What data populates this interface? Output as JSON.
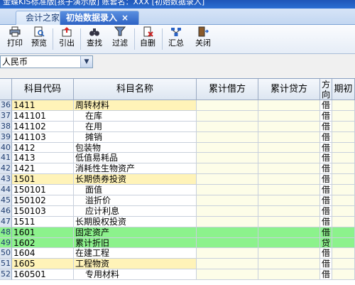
{
  "titlebar": {
    "text": "金蝶KIS标准版[孩子演示版]  账套名：XXX  [初始数据录入]"
  },
  "tabs": [
    {
      "label": "会计之家",
      "active": false
    },
    {
      "label": "初始数据录入",
      "active": true,
      "close": "×"
    }
  ],
  "toolbar": {
    "buttons": [
      {
        "label": "打印",
        "icon": "printer-icon"
      },
      {
        "label": "预览",
        "icon": "preview-icon"
      },
      {
        "label": "引出",
        "icon": "export-icon"
      },
      {
        "label": "查找",
        "icon": "binoculars-icon"
      },
      {
        "label": "过滤",
        "icon": "filter-icon"
      },
      {
        "label": "自删",
        "icon": "delete-icon"
      },
      {
        "label": "汇总",
        "icon": "summary-icon"
      },
      {
        "label": "关闭",
        "icon": "close-door-icon"
      }
    ]
  },
  "currency": {
    "value": "人民币",
    "arrow": "▼"
  },
  "grid": {
    "headers": {
      "code": "科目代码",
      "name": "科目名称",
      "debit": "累计借方",
      "credit": "累计贷方",
      "dir": "方向",
      "end": "期初"
    },
    "rows": [
      {
        "num": "36",
        "code": "1411",
        "name": "周转材料",
        "dir": "借",
        "style": "hl"
      },
      {
        "num": "37",
        "code": "141101",
        "name": "在库",
        "dir": "借",
        "indent": true
      },
      {
        "num": "38",
        "code": "141102",
        "name": "在用",
        "dir": "借",
        "indent": true
      },
      {
        "num": "39",
        "code": "141103",
        "name": "摊销",
        "dir": "借",
        "indent": true
      },
      {
        "num": "40",
        "code": "1412",
        "name": "包装物",
        "dir": "借"
      },
      {
        "num": "41",
        "code": "1413",
        "name": "低值易耗品",
        "dir": "借"
      },
      {
        "num": "42",
        "code": "1421",
        "name": "消耗性生物资产",
        "dir": "借"
      },
      {
        "num": "43",
        "code": "1501",
        "name": "长期债券投资",
        "dir": "借",
        "style": "hl"
      },
      {
        "num": "44",
        "code": "150101",
        "name": "面值",
        "dir": "借",
        "indent": true
      },
      {
        "num": "45",
        "code": "150102",
        "name": "溢折价",
        "dir": "借",
        "indent": true
      },
      {
        "num": "46",
        "code": "150103",
        "name": "应计利息",
        "dir": "借",
        "indent": true
      },
      {
        "num": "47",
        "code": "1511",
        "name": "长期股权投资",
        "dir": "借"
      },
      {
        "num": "48",
        "code": "1601",
        "name": "固定资产",
        "dir": "借",
        "style": "green"
      },
      {
        "num": "49",
        "code": "1602",
        "name": "累计折旧",
        "dir": "贷",
        "style": "green"
      },
      {
        "num": "50",
        "code": "1604",
        "name": "在建工程",
        "dir": "借"
      },
      {
        "num": "51",
        "code": "1605",
        "name": "工程物资",
        "dir": "借",
        "style": "hl"
      },
      {
        "num": "52",
        "code": "160501",
        "name": "专用材料",
        "dir": "借",
        "indent": true
      }
    ]
  }
}
